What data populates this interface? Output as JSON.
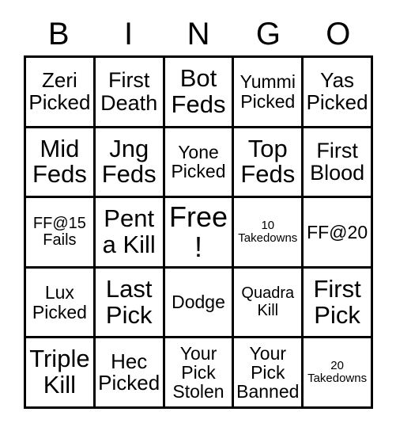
{
  "card": {
    "title": "BINGO",
    "header_letters": [
      "B",
      "I",
      "N",
      "G",
      "O"
    ],
    "colors": {
      "background": "#ffffff",
      "border": "#000000",
      "text": "#000000"
    },
    "grid": {
      "rows": 5,
      "columns": 5,
      "free_space": {
        "row": 3,
        "column": 3,
        "label": "Free!"
      }
    },
    "cells": [
      {
        "id": "b1",
        "line1": "Zeri",
        "line2": "Picked",
        "text": "Zeri Picked",
        "size": "lg"
      },
      {
        "id": "i1",
        "line1": "First",
        "line2": "Death",
        "text": "First Death",
        "size": "lg"
      },
      {
        "id": "n1",
        "line1": "Bot",
        "line2": "Feds",
        "text": "Bot Feds",
        "size": "xl"
      },
      {
        "id": "g1",
        "line1": "Yummi",
        "line2": "Picked",
        "text": "Yummi Picked",
        "size": "md"
      },
      {
        "id": "o1",
        "line1": "Yas",
        "line2": "Picked",
        "text": "Yas Picked",
        "size": "lg"
      },
      {
        "id": "b2",
        "line1": "Mid",
        "line2": "Feds",
        "text": "Mid Feds",
        "size": "xl"
      },
      {
        "id": "i2",
        "line1": "Jng",
        "line2": "Feds",
        "text": "Jng Feds",
        "size": "xl"
      },
      {
        "id": "n2",
        "line1": "Yone",
        "line2": "Picked",
        "text": "Yone Picked",
        "size": "md"
      },
      {
        "id": "g2",
        "line1": "Top",
        "line2": "Feds",
        "text": "Top Feds",
        "size": "xl"
      },
      {
        "id": "o2",
        "line1": "First",
        "line2": "Blood",
        "text": "First Blood",
        "size": "lg"
      },
      {
        "id": "b3",
        "line1": "FF@15",
        "line2": "Fails",
        "text": "FF@15 Fails",
        "size": "sm"
      },
      {
        "id": "i3",
        "line1": "Penta",
        "line2": "Kill",
        "text": "Penta Kill",
        "size": "xl"
      },
      {
        "id": "n3",
        "line1": "Free!",
        "line2": "",
        "text": "Free!",
        "size": "xxl"
      },
      {
        "id": "g3",
        "line1": "10",
        "line2": "Takedowns",
        "text": "10 Takedowns",
        "size": "xs"
      },
      {
        "id": "o3",
        "line1": "FF@20",
        "line2": "",
        "text": "FF@20",
        "size": "md"
      },
      {
        "id": "b4",
        "line1": "Lux",
        "line2": "Picked",
        "text": "Lux Picked",
        "size": "md"
      },
      {
        "id": "i4",
        "line1": "Last",
        "line2": "Pick",
        "text": "Last Pick",
        "size": "xl"
      },
      {
        "id": "n4",
        "line1": "Dodge",
        "line2": "",
        "text": "Dodge",
        "size": "md"
      },
      {
        "id": "g4",
        "line1": "Quadra",
        "line2": "Kill",
        "text": "Quadra Kill",
        "size": "sm"
      },
      {
        "id": "o4",
        "line1": "First",
        "line2": "Pick",
        "text": "First Pick",
        "size": "xl"
      },
      {
        "id": "b5",
        "line1": "Triple",
        "line2": "Kill",
        "text": "Triple Kill",
        "size": "xl"
      },
      {
        "id": "i5",
        "line1": "Hec",
        "line2": "Picked",
        "text": "Hec Picked",
        "size": "lg"
      },
      {
        "id": "n5",
        "line1": "Your\nPick\nStolen",
        "line2": "",
        "text": "Your Pick Stolen",
        "size": "md"
      },
      {
        "id": "g5",
        "line1": "Your\nPick\nBanned",
        "line2": "",
        "text": "Your Pick Banned",
        "size": "md"
      },
      {
        "id": "o5",
        "line1": "20",
        "line2": "Takedowns",
        "text": "20 Takedowns",
        "size": "xs"
      }
    ]
  }
}
